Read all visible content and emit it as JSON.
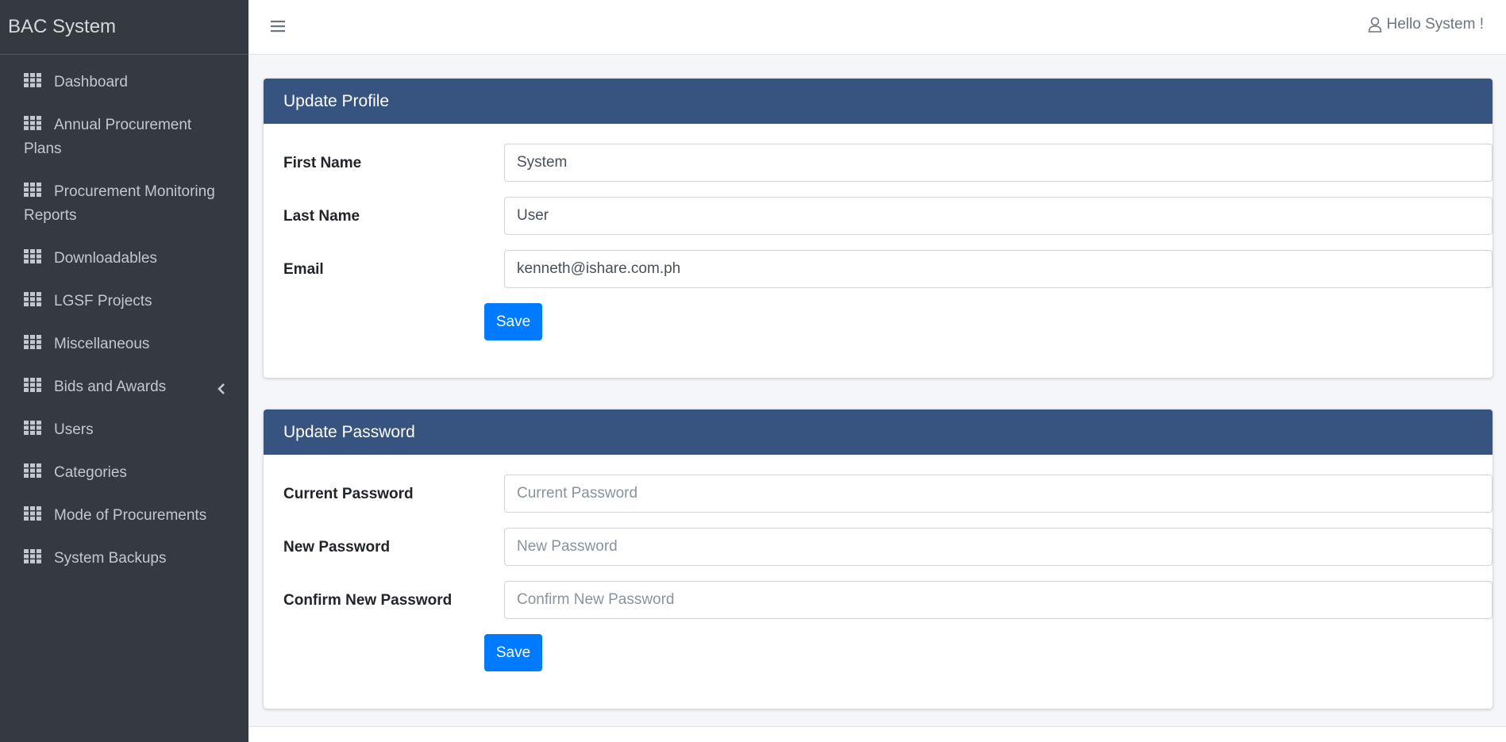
{
  "brand": "BAC System",
  "sidebar": {
    "items": [
      {
        "label": "Dashboard",
        "icon": "grid-icon"
      },
      {
        "label": "Annual Procurement Plans",
        "icon": "grid-icon"
      },
      {
        "label": "Procurement Monitoring Reports",
        "icon": "grid-icon"
      },
      {
        "label": "Downloadables",
        "icon": "grid-icon"
      },
      {
        "label": "LGSF Projects",
        "icon": "grid-icon"
      },
      {
        "label": "Miscellaneous",
        "icon": "grid-icon"
      },
      {
        "label": "Bids and Awards",
        "icon": "grid-icon",
        "has_submenu": true
      },
      {
        "label": "Users",
        "icon": "grid-icon"
      },
      {
        "label": "Categories",
        "icon": "grid-icon"
      },
      {
        "label": "Mode of Procurements",
        "icon": "grid-icon"
      },
      {
        "label": "System Backups",
        "icon": "grid-icon"
      }
    ]
  },
  "header": {
    "greeting": "Hello System !"
  },
  "profile": {
    "title": "Update Profile",
    "first_name_label": "First Name",
    "first_name_value": "System",
    "last_name_label": "Last Name",
    "last_name_value": "User",
    "email_label": "Email",
    "email_value": "kenneth@ishare.com.ph",
    "save_label": "Save"
  },
  "password": {
    "title": "Update Password",
    "current_label": "Current Password",
    "current_placeholder": "Current Password",
    "new_label": "New Password",
    "new_placeholder": "New Password",
    "confirm_label": "Confirm New Password",
    "confirm_placeholder": "Confirm New Password",
    "save_label": "Save"
  },
  "colors": {
    "sidebar_bg": "#343a40",
    "card_header_bg": "#375480",
    "primary": "#007bff"
  }
}
